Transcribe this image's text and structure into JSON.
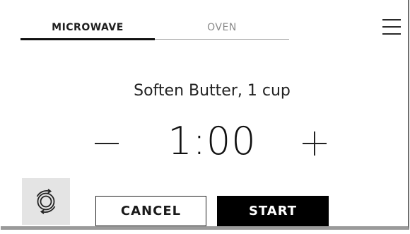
{
  "tabs": [
    {
      "label": "MICROWAVE",
      "active": true
    },
    {
      "label": "OVEN",
      "active": false
    }
  ],
  "menu": {
    "icon": "hamburger-menu-icon"
  },
  "program": {
    "title": "Soften Butter, 1 cup"
  },
  "timer": {
    "value": "1:00"
  },
  "controls": {
    "decrement_icon": "minus-icon",
    "increment_icon": "plus-icon",
    "turntable_icon": "turntable-icon",
    "cancel_label": "CANCEL",
    "start_label": "START"
  },
  "colors": {
    "background": "#ffffff",
    "text": "#1a1a1a",
    "inactive_tab": "#8a8a8a",
    "primary_button": "#000000",
    "icon_tile": "#e4e4e4"
  }
}
